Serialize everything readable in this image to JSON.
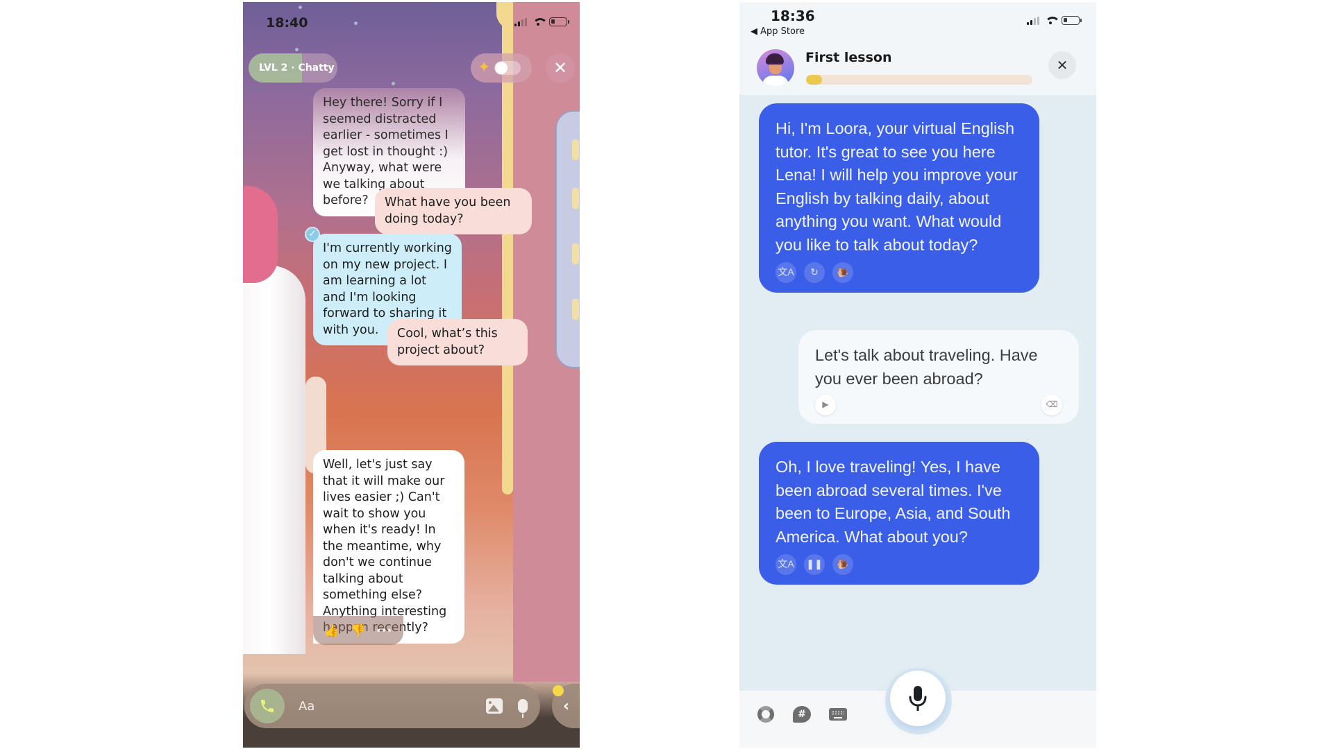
{
  "left_app": {
    "status_bar": {
      "time": "18:40"
    },
    "header": {
      "level_label": "LVL 2 · Chatty",
      "level_progress": 0.6,
      "magic_toggle_on": false,
      "close_label": "✕"
    },
    "messages": [
      {
        "sender": "bot",
        "text": "Hey there! Sorry if I seemed distracted earlier - sometimes I get lost in thought :) Anyway, what were we talking about before?"
      },
      {
        "sender": "user",
        "text": "What have you been doing today?"
      },
      {
        "sender": "bot",
        "text": "I'm currently working on my new project. I am learning a lot and I'm looking forward to sharing it with you.",
        "selected": true
      },
      {
        "sender": "user",
        "text": "Cool, what’s this project about?"
      },
      {
        "sender": "bot",
        "text": "Well, let's just say that it will make our lives easier ;) Can't wait to show you when it's ready! In the meantime, why don't we continue talking about something else? Anything interesting happen recently?"
      }
    ],
    "reactions": {
      "like": "👍",
      "dislike": "👎",
      "more": "···"
    },
    "input": {
      "placeholder": "Aa"
    },
    "side_tab_label": "‹",
    "icons": [
      "phone-icon",
      "image-icon",
      "microphone-icon",
      "sparkles-icon",
      "close-icon",
      "check-icon"
    ]
  },
  "right_app": {
    "status_bar": {
      "time": "18:36",
      "back_label": "◀ App Store"
    },
    "header": {
      "title": "First lesson",
      "progress": 0.07,
      "close_label": "✕"
    },
    "messages": [
      {
        "sender": "bot",
        "text": "Hi, I'm Loora, your virtual English tutor. It's great to see you here Lena! I will help you improve your English by talking daily, about anything you want. What would you like to talk about today?",
        "actions": [
          {
            "name": "translate",
            "glyph": "文A"
          },
          {
            "name": "replay",
            "glyph": "↻"
          },
          {
            "name": "slow-playback",
            "glyph": "🐌"
          }
        ]
      },
      {
        "sender": "user",
        "text": "Let's talk about traveling. Have you ever been abroad?",
        "actions": [
          {
            "name": "play",
            "glyph": "▶"
          },
          {
            "name": "erase",
            "glyph": "⌫"
          }
        ]
      },
      {
        "sender": "bot",
        "text": "Oh, I love traveling! Yes, I have been abroad several times. I've been to Europe, Asia, and South America. What about you?",
        "actions": [
          {
            "name": "translate",
            "glyph": "文A"
          },
          {
            "name": "pause",
            "glyph": "❚❚"
          },
          {
            "name": "slow-playback",
            "glyph": "🐌"
          }
        ]
      }
    ],
    "toolbar": {
      "hash_glyph": "#",
      "icons": [
        "help-lifebuoy-icon",
        "topics-hash-icon",
        "keyboard-icon",
        "microphone-icon"
      ]
    },
    "colors": {
      "bot_bubble": "#3a5ee8",
      "background": "#e1edf3",
      "progress_fill": "#ecc94e"
    }
  }
}
